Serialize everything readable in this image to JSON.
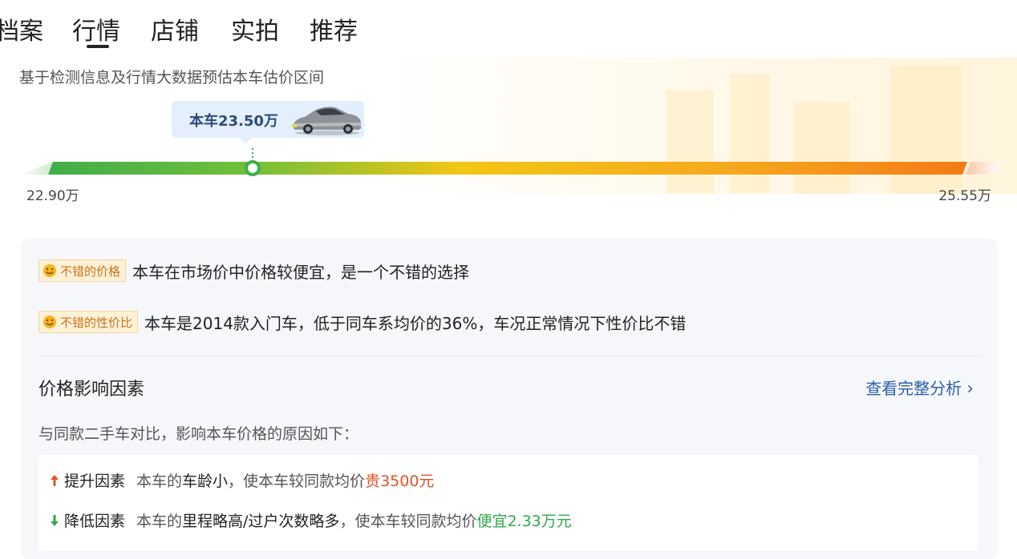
{
  "tabs": [
    {
      "label": "档案"
    },
    {
      "label": "行情"
    },
    {
      "label": "店铺"
    },
    {
      "label": "实拍"
    },
    {
      "label": "推荐"
    }
  ],
  "active_tab": "行情",
  "subtitle": "基于检测信息及行情大数据预估本车估价区间",
  "price": {
    "current_label": "本车23.50万",
    "min_label": "22.90万",
    "max_label": "25.55万",
    "min": 22.9,
    "max": 25.55,
    "current": 23.5
  },
  "colors": {
    "green": "#3fae49",
    "yellow": "#f3c614",
    "orange": "#f47a16",
    "link": "#2b5fa8",
    "up": "#e0522a",
    "down": "#2fa84a"
  },
  "evaluations": [
    {
      "icon": "smile-icon",
      "tag": "不错的价格",
      "text": "本车在市场价中价格较便宜，是一个不错的选择"
    },
    {
      "icon": "smile-icon",
      "tag": "不错的性价比",
      "text": "本车是2014款入门车，低于同车系均价的36%，车况正常情况下性价比不错"
    }
  ],
  "factors": {
    "title": "价格影响因素",
    "more_link": "查看完整分析",
    "description": "与同款二手车对比，影响本车价格的原因如下：",
    "items": [
      {
        "direction": "up",
        "label": "提升因素",
        "prefix": "本车的",
        "highlight": "车龄小",
        "middle": "，使本车较同款均价",
        "value": "贵3500元"
      },
      {
        "direction": "down",
        "label": "降低因素",
        "prefix": "本车的",
        "highlight": "里程略高/过户次数略多",
        "middle": "，使本车较同款均价",
        "value": "便宜2.33万元"
      }
    ]
  }
}
